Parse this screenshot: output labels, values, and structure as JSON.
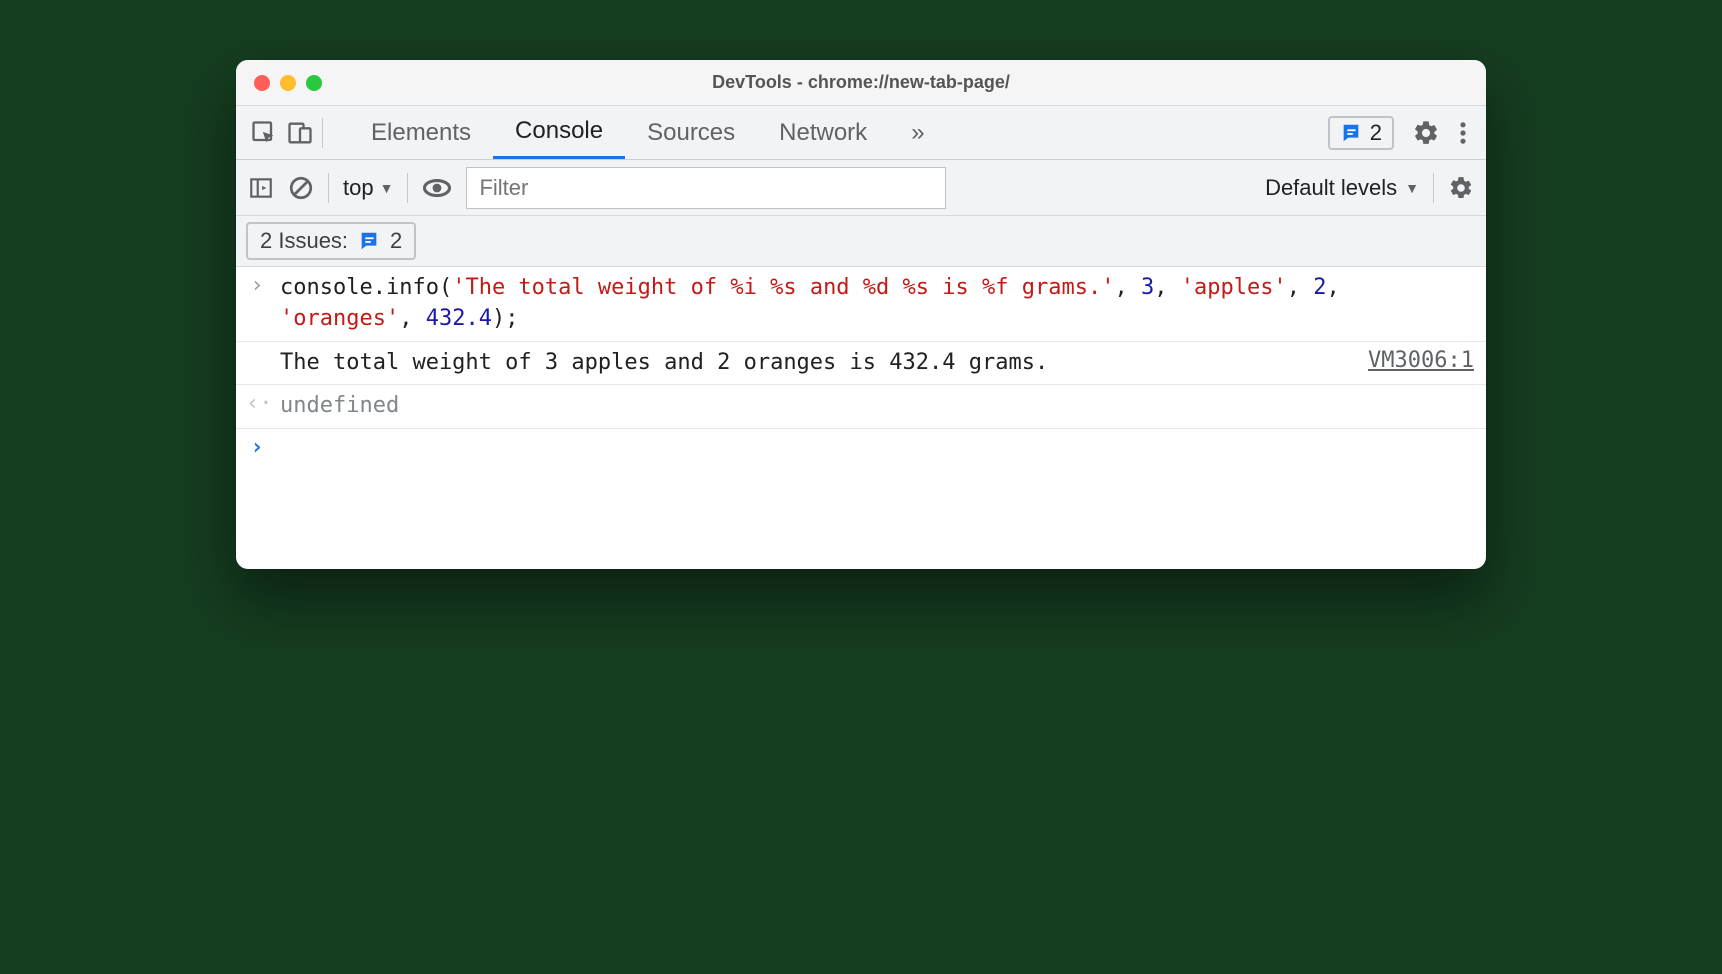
{
  "window": {
    "title": "DevTools - chrome://new-tab-page/"
  },
  "tabs": {
    "items": [
      "Elements",
      "Console",
      "Sources",
      "Network"
    ],
    "active_index": 1,
    "overflow_glyph": "»"
  },
  "header": {
    "issues_count": "2"
  },
  "toolbar": {
    "context": "top",
    "filter_placeholder": "Filter",
    "levels_label": "Default levels"
  },
  "issuesbar": {
    "label": "2 Issues:",
    "count": "2"
  },
  "console": {
    "input_tokens": [
      {
        "t": "obj",
        "v": "console"
      },
      {
        "t": "pun",
        "v": "."
      },
      {
        "t": "prop",
        "v": "info"
      },
      {
        "t": "pun",
        "v": "("
      },
      {
        "t": "str",
        "v": "'The total weight of %i %s and %d %s is %f grams.'"
      },
      {
        "t": "pun",
        "v": ", "
      },
      {
        "t": "num",
        "v": "3"
      },
      {
        "t": "pun",
        "v": ", "
      },
      {
        "t": "str",
        "v": "'apples'"
      },
      {
        "t": "pun",
        "v": ", "
      },
      {
        "t": "num",
        "v": "2"
      },
      {
        "t": "pun",
        "v": ", "
      },
      {
        "t": "str",
        "v": "'oranges'"
      },
      {
        "t": "pun",
        "v": ", "
      },
      {
        "t": "num",
        "v": "432.4"
      },
      {
        "t": "pun",
        "v": ");"
      }
    ],
    "output_text": "The total weight of 3 apples and 2 oranges is 432.4 grams.",
    "output_source": "VM3006:1",
    "return_value": "undefined"
  }
}
